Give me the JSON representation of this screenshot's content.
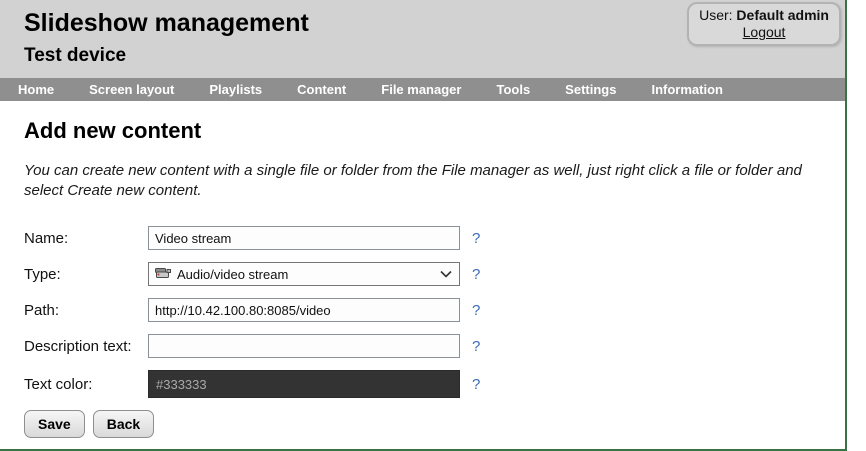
{
  "header": {
    "title": "Slideshow management",
    "subtitle": "Test device",
    "user_label": "User:",
    "user_name": "Default admin",
    "logout_label": "Logout"
  },
  "nav": {
    "items": [
      "Home",
      "Screen layout",
      "Playlists",
      "Content",
      "File manager",
      "Tools",
      "Settings",
      "Information"
    ]
  },
  "main": {
    "heading": "Add new content",
    "description": "You can create new content with a single file or folder from the File manager as well, just right click a file or folder and select Create new content.",
    "form": {
      "name": {
        "label": "Name:",
        "value": "Video stream",
        "help": "?"
      },
      "type": {
        "label": "Type:",
        "value": "Audio/video stream",
        "icon": "camcorder-icon",
        "help": "?"
      },
      "path": {
        "label": "Path:",
        "value": "http://10.42.100.80:8085/video",
        "help": "?"
      },
      "description_text": {
        "label": "Description text:",
        "value": "",
        "help": "?"
      },
      "text_color": {
        "label": "Text color:",
        "value": "#333333",
        "background": "#333333",
        "help": "?"
      }
    },
    "buttons": {
      "save": "Save",
      "back": "Back"
    }
  },
  "colors": {
    "accent_green": "#3a7243",
    "nav_gray": "#8f8f8f",
    "header_gray": "#d2d2d2",
    "help_blue": "#3b6bb5"
  }
}
